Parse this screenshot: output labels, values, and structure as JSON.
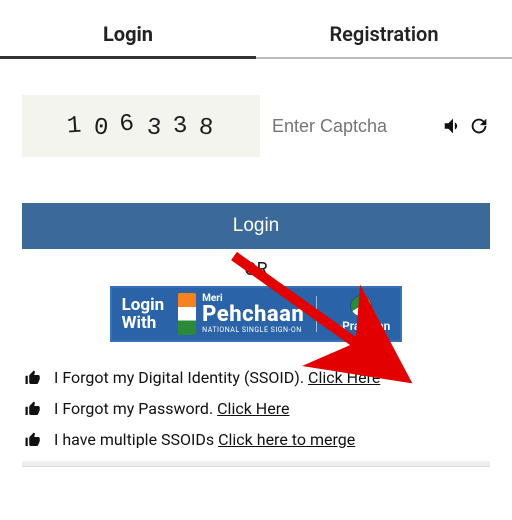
{
  "tabs": {
    "login": "Login",
    "registration": "Registration"
  },
  "captcha": {
    "chars": [
      "1",
      "0",
      "6",
      "3",
      "3",
      "8"
    ],
    "placeholder": "Enter Captcha"
  },
  "loginButton": "Login",
  "or": "OR",
  "pehchaan": {
    "loginWithTop": "Login",
    "loginWithBottom": "With",
    "meri": "Meri",
    "name": "Pehchaan",
    "sub": "NATIONAL SINGLE SIGN-ON",
    "ep": "e-Pramaan"
  },
  "links": {
    "l1_text": "I Forgot my Digital Identity (SSOID). ",
    "l1_link": "Click Here",
    "l2_text": "I Forgot my Password. ",
    "l2_link": "Click Here",
    "l3_text": "I have multiple SSOIDs ",
    "l3_link": "Click here to merge"
  }
}
